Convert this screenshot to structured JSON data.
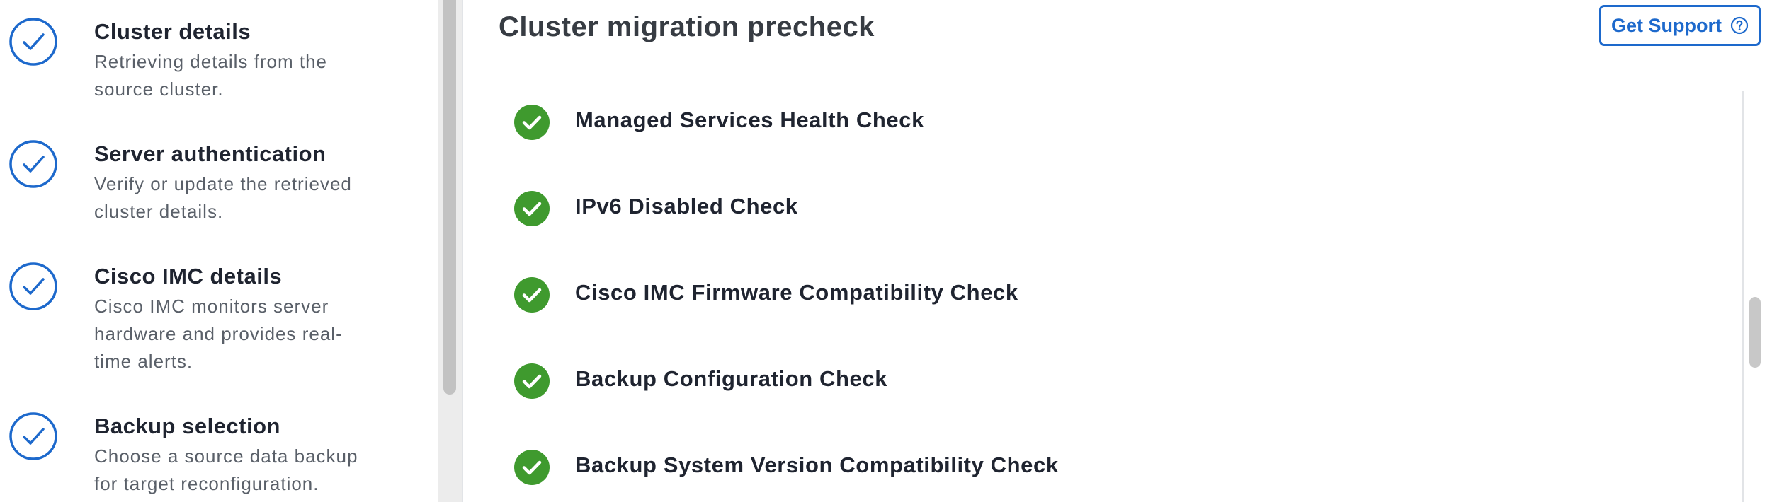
{
  "sidebar": {
    "steps": [
      {
        "title": "Cluster details",
        "desc_lines": [
          "Retrieving details from the",
          "source cluster."
        ],
        "icon": "check-circle-icon"
      },
      {
        "title": "Server authentication",
        "desc_lines": [
          "Verify or update the retrieved",
          "cluster details."
        ],
        "icon": "check-circle-icon"
      },
      {
        "title": "Cisco IMC details",
        "desc_lines": [
          "Cisco IMC monitors server",
          "hardware and provides real-",
          "time alerts."
        ],
        "icon": "check-circle-icon"
      },
      {
        "title": "Backup selection",
        "desc_lines": [
          "Choose a source data backup",
          "for target reconfiguration."
        ],
        "icon": "check-circle-icon"
      }
    ]
  },
  "main": {
    "title": "Cluster migration precheck",
    "support_button": {
      "label": "Get Support",
      "icon": "help-circle-icon"
    },
    "checks": [
      {
        "label": "Managed Services Health Check",
        "status": "passed"
      },
      {
        "label": "IPv6 Disabled Check",
        "status": "passed"
      },
      {
        "label": "Cisco IMC Firmware Compatibility Check",
        "status": "passed"
      },
      {
        "label": "Backup Configuration Check",
        "status": "passed"
      },
      {
        "label": "Backup System Version Compatibility Check",
        "status": "passed"
      }
    ]
  },
  "colors": {
    "step_icon": "#1d69cc",
    "success": "#3f9a2e",
    "link": "#1d69cc"
  }
}
